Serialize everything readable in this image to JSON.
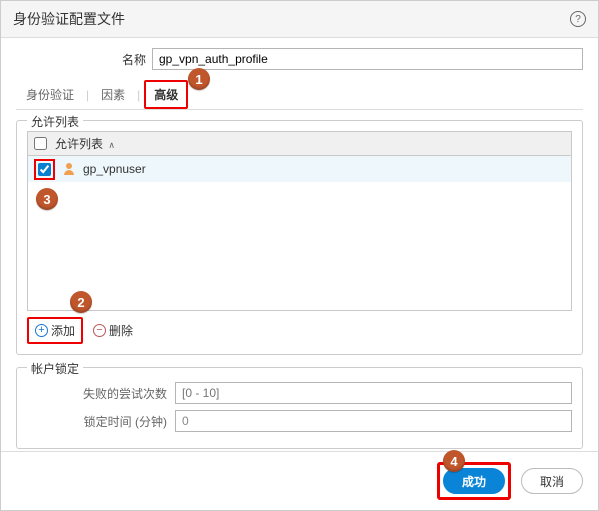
{
  "dialog": {
    "title": "身份验证配置文件",
    "help_icon": "?"
  },
  "name_field": {
    "label": "名称",
    "value": "gp_vpn_auth_profile"
  },
  "tabs": {
    "auth": "身份验证",
    "factor": "因素",
    "advanced": "高级"
  },
  "allow_list": {
    "legend": "允许列表",
    "column_header": "允许列表",
    "rows": [
      {
        "checked": true,
        "icon": "user-icon",
        "name": "gp_vpnuser"
      }
    ],
    "actions": {
      "add": "添加",
      "delete": "删除"
    }
  },
  "lockout": {
    "legend": "帐户锁定",
    "attempts_label": "失败的尝试次数",
    "attempts_placeholder": "[0 - 10]",
    "duration_label": "锁定时间 (分钟)",
    "duration_value": "0"
  },
  "footer": {
    "ok": "成功",
    "cancel": "取消"
  },
  "callouts": {
    "b1": "1",
    "b2": "2",
    "b3": "3",
    "b4": "4"
  }
}
